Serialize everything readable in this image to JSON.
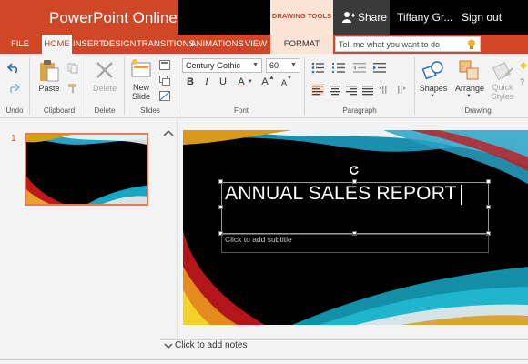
{
  "app": {
    "brand": "PowerPoint Online",
    "contextual_tab_group": "DRAWING TOOLS",
    "share_label": "Share",
    "user_name": "Tiffany Gr...",
    "signout_label": "Sign out",
    "accent_color": "#d04727"
  },
  "ribbon_tabs": [
    {
      "label": "FILE",
      "active": false
    },
    {
      "label": "HOME",
      "active": true
    },
    {
      "label": "INSERT",
      "active": false
    },
    {
      "label": "DESIGN",
      "active": false
    },
    {
      "label": "TRANSITIONS",
      "active": false
    },
    {
      "label": "ANIMATIONS",
      "active": false
    },
    {
      "label": "VIEW",
      "active": false
    },
    {
      "label": "FORMAT",
      "active": false
    }
  ],
  "tell_me": {
    "placeholder": "Tell me what you want to do",
    "icon": "lightbulb-icon"
  },
  "ribbon": {
    "groups": {
      "undo": "Undo",
      "clipboard": "Clipboard",
      "delete": "Delete",
      "slides": "Slides",
      "font": "Font",
      "paragraph": "Paragraph",
      "drawing": "Drawing"
    },
    "paste": "Paste",
    "delete_btn": "Delete",
    "new_slide": [
      "New",
      "Slide"
    ],
    "font_name": "Century Gothic",
    "font_size": "60",
    "bold": "B",
    "italic": "I",
    "underline": "U",
    "font_color": "A",
    "grow": "A",
    "shrink": "A",
    "shapes": "Shapes",
    "arrange": "Arrange",
    "quick_styles": [
      "Quick",
      "Styles"
    ]
  },
  "thumbnails": [
    {
      "number": "1"
    }
  ],
  "slide": {
    "title": "ANNUAL SALES REPORT",
    "subtitle_placeholder": "Click to add subtitle"
  },
  "notes": {
    "placeholder": "Click to add notes"
  }
}
